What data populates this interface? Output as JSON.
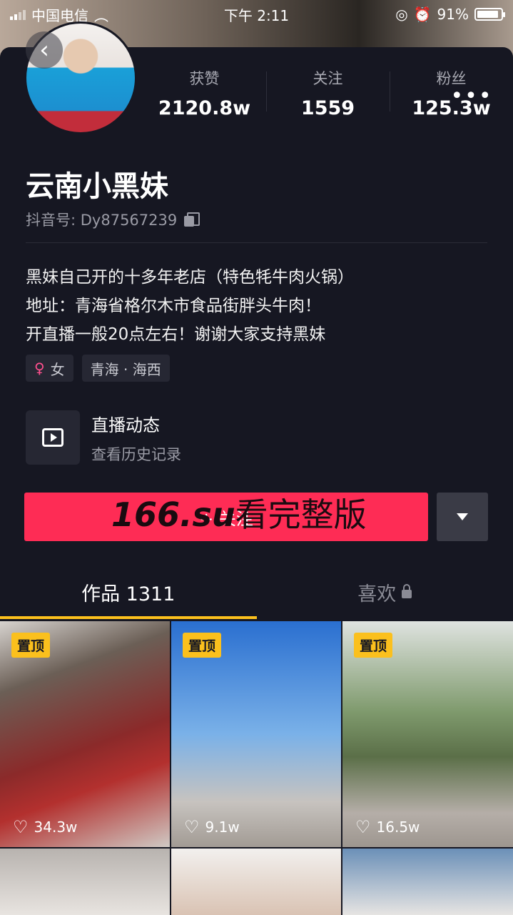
{
  "status_bar": {
    "carrier": "中国电信",
    "time": "下午 2:11",
    "battery": "91%",
    "battery_level": 0.91
  },
  "profile": {
    "stats": [
      {
        "label": "获赞",
        "value": "2120.8w"
      },
      {
        "label": "关注",
        "value": "1559"
      },
      {
        "label": "粉丝",
        "value": "125.3w"
      }
    ],
    "nickname": "云南小黑妹",
    "uid": "抖音号: Dy87567239",
    "bio": [
      "黑妹自己开的十多年老店（特色牦牛肉火锅）",
      "地址：青海省格尔木市食品街胖头牛肉！",
      "开直播一般20点左右！谢谢大家支持黑妹"
    ],
    "tags": {
      "gender": "女",
      "location": "青海 · 海西"
    }
  },
  "live": {
    "title": "直播动态",
    "subtitle": "查看历史记录"
  },
  "follow_button": {
    "label": "+ 关注",
    "watermark_prefix": "166.su",
    "watermark_suffix": "看完整版"
  },
  "tabs": {
    "works": "作品 1311",
    "likes": "喜欢"
  },
  "videos": [
    {
      "pinned": "置顶",
      "likes": "34.3w"
    },
    {
      "pinned": "置顶",
      "likes": "9.1w"
    },
    {
      "pinned": "置顶",
      "likes": "16.5w"
    }
  ],
  "icons": [
    "back-icon",
    "more-icon",
    "copy-icon",
    "female-icon",
    "tv-icon",
    "dropdown-icon",
    "lock-icon",
    "heart-icon"
  ],
  "colors": {
    "accent": "#fe2c55",
    "tab_indicator": "#fbc01d",
    "background": "#161722"
  }
}
